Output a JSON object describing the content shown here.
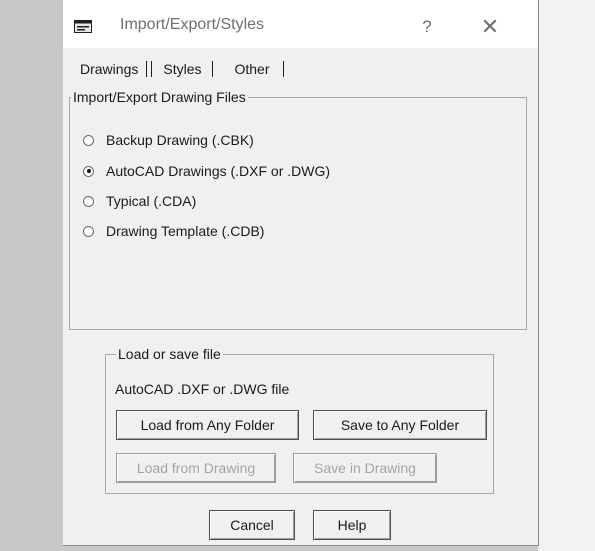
{
  "window": {
    "title": "Import/Export/Styles",
    "help_glyph": "?",
    "close_glyph": "✕"
  },
  "tabs": [
    "Drawings",
    "Styles",
    "Other"
  ],
  "import_group": {
    "legend": "Import/Export Drawing Files",
    "options": [
      {
        "label": "Backup Drawing (.CBK)",
        "checked": false
      },
      {
        "label": "AutoCAD Drawings (.DXF or .DWG)",
        "checked": true
      },
      {
        "label": "Typical (.CDA)",
        "checked": false
      },
      {
        "label": "Drawing Template (.CDB)",
        "checked": false
      }
    ]
  },
  "file_group": {
    "legend": "Load or save file",
    "description": "AutoCAD .DXF or .DWG file",
    "buttons": {
      "load_any": "Load from Any Folder",
      "save_any": "Save to Any Folder",
      "load_drawing": "Load from Drawing",
      "save_drawing": "Save in Drawing"
    }
  },
  "footer": {
    "cancel": "Cancel",
    "help": "Help"
  }
}
